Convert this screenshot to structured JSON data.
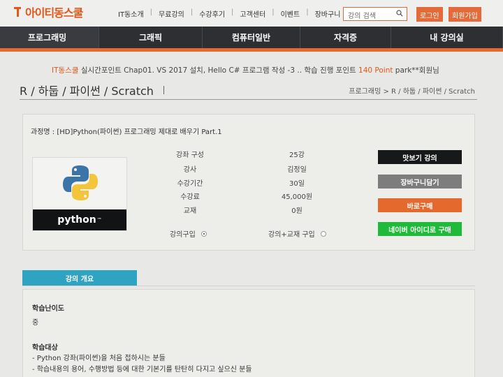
{
  "brand": {
    "name": "아이티동스쿨",
    "accent": "#e0591c"
  },
  "topnav": [
    "IT동소개",
    "무료강의",
    "수강후기",
    "고객센터",
    "이벤트",
    "장바구니"
  ],
  "search": {
    "placeholder": "강의 검색",
    "icon": "search-icon"
  },
  "auth": {
    "login": "로그인",
    "signup": "회원가입"
  },
  "mainnav": [
    "프로그래밍",
    "그래픽",
    "컴퓨터일반",
    "자격증",
    "내 강의실"
  ],
  "ticker": {
    "prefix": "IT동스쿨",
    "text": " 실시간포인트 Chap01. VS 2017 설치, Hello C# 프로그램 작성 -3 .. 학습 진행 포인트 ",
    "points": "140 Point",
    "suffix": " park**회원님"
  },
  "page": {
    "title": "R / 하둡 / 파이썬 / Scratch",
    "breadcrumb": "프로그래밍 > R / 하둡 / 파이썬 / Scratch"
  },
  "course": {
    "name": "과정명 : [HD]Python(파이썬) 프로그래밍 제대로 배우기 Part.1",
    "logo_text": "python",
    "logo_tm": "™",
    "info": [
      {
        "label": "강좌 구성",
        "value": "25강"
      },
      {
        "label": "강사",
        "value": "김정일"
      },
      {
        "label": "수강기간",
        "value": "30일"
      },
      {
        "label": "수강료",
        "value": "45,000원"
      },
      {
        "label": "교재",
        "value": "0원"
      }
    ],
    "options": [
      {
        "label": "강의구입",
        "selected": true
      },
      {
        "label": "강의+교재 구입",
        "selected": false
      }
    ],
    "actions": [
      {
        "label": "맛보기 강의",
        "color": "#17181a"
      },
      {
        "label": "장바구니담기",
        "color": "#7d7d7d"
      },
      {
        "label": "바로구매",
        "color": "#e4692c"
      },
      {
        "label": "네이버 아이디로 구매",
        "color": "#1fba3a"
      }
    ]
  },
  "intro": {
    "tab": "강의 개요",
    "difficulty_title": "학습난이도",
    "difficulty_value": "중",
    "target_title": "학습대상",
    "targets": [
      "- Python 강좌(파이썬)을 처음 접하시는 분들",
      "- 학습내용의 용어, 수행방법 등에 대한 기본기를 탄탄히 다지고 싶으신 분들"
    ]
  }
}
